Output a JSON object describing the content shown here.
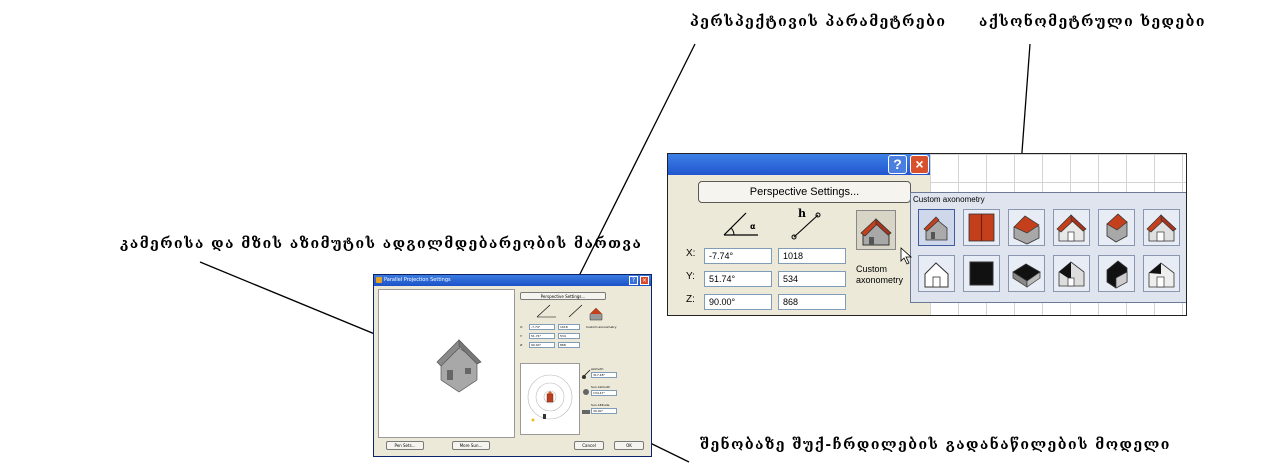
{
  "annotations": {
    "perspective_params": "პერსპექტივის პარამეტრები",
    "axonometric_views": "აქსონომეტრული ხედები",
    "camera_sun_control": "კამერისა და მზის აზიმუტის ადგილმდებარეობის მართვა",
    "shadow_model": "შენობაზე შუქ-ჩრდილების გადანაწილების მოდელი"
  },
  "small_dialog": {
    "title": "Parallel Projection Settings",
    "help": "?",
    "close": "×",
    "perspective_button": "Perspective Settings...",
    "axis_labels": [
      "X:",
      "Y:",
      "Z:"
    ],
    "angle_values": [
      "-7.74°",
      "51.74°",
      "90.00°"
    ],
    "length_values": [
      "1018",
      "534",
      "868"
    ],
    "custom_label": "Custom axonometry",
    "azimuth_label": "Azimuth",
    "azimuth_value": "317.48°",
    "sun_azimuth_label": "Sun Azimuth",
    "sun_azimuth_value": "134.47°",
    "sun_altitude_label": "Sun Altitude",
    "sun_altitude_value": "30.00°",
    "pen_sets_button": "Pen Sets...",
    "more_sun_button": "More Sun...",
    "cancel_button": "Cancel",
    "ok_button": "OK"
  },
  "zoom_panel": {
    "help": "?",
    "close": "×",
    "perspective_button": "Perspective Settings...",
    "axis_labels": [
      "X:",
      "Y:",
      "Z:"
    ],
    "angle_values": [
      "-7.74°",
      "51.74°",
      "90.00°"
    ],
    "length_values": [
      "1018",
      "534",
      "868"
    ],
    "custom_label": "Custom axonometry",
    "popup_title": "Custom axonometry"
  },
  "colors": {
    "roof": "#c4401c",
    "house_body": "#9a9a9a",
    "title_blue": "#2156cf",
    "close_red": "#d9502c"
  }
}
